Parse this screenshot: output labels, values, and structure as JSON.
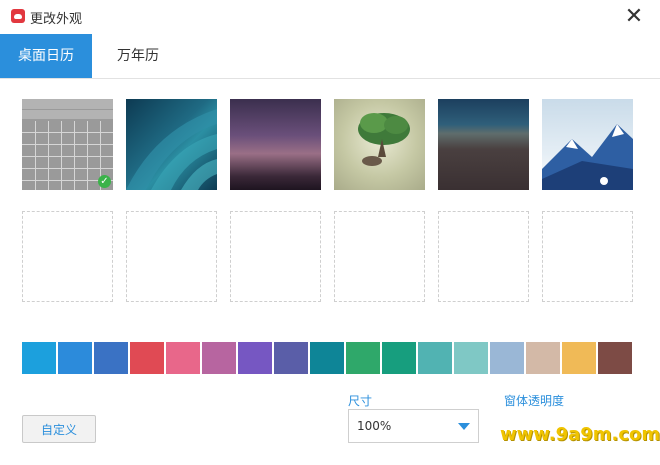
{
  "window": {
    "title": "更改外观",
    "close_symbol": "✕"
  },
  "tabs": [
    {
      "label": "桌面日历",
      "active": true
    },
    {
      "label": "万年历",
      "active": false
    }
  ],
  "themes": [
    {
      "name": "calendar-grid",
      "selected": true
    },
    {
      "name": "teal-leaves",
      "selected": false
    },
    {
      "name": "purple-dusk",
      "selected": false
    },
    {
      "name": "floating-tree",
      "selected": false
    },
    {
      "name": "ocean-horizon",
      "selected": false
    },
    {
      "name": "blue-mountains",
      "selected": false
    }
  ],
  "empty_slots": 6,
  "colors": [
    "#1ca0dd",
    "#2c8bdb",
    "#3a72c4",
    "#e04a54",
    "#e8678a",
    "#b765a0",
    "#7657c2",
    "#5a5ea8",
    "#0e8597",
    "#2fa86a",
    "#179e7e",
    "#51b3b2",
    "#7fc8c5",
    "#9ab7d6",
    "#d3b9a7",
    "#f0ba57",
    "#7d4b45"
  ],
  "custom_button": "自定义",
  "size": {
    "label": "尺寸",
    "value": "100%"
  },
  "transparency": {
    "label": "窗体透明度"
  },
  "watermark": "www.9a9m.com"
}
